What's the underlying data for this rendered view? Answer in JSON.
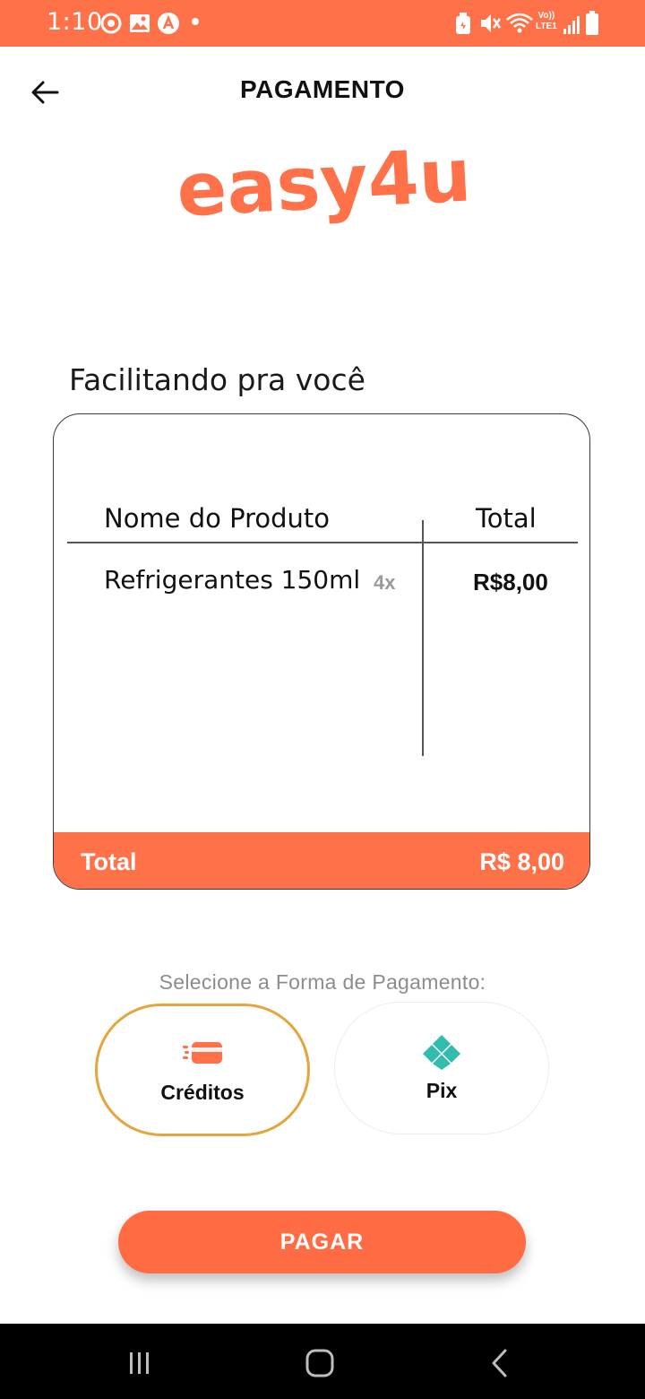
{
  "status_bar": {
    "time": "1:10",
    "icons": [
      "notification-icon",
      "gallery-icon",
      "app-icon",
      "dot-icon"
    ],
    "right_icons": [
      "battery-saver-icon",
      "mute-icon",
      "wifi-icon",
      "volte-icon",
      "signal-icon",
      "battery-icon"
    ],
    "volte_text": "Vo))",
    "lte_text": "LTE1",
    "color": "#ff7148"
  },
  "header": {
    "title": "PAGAMENTO",
    "back_icon": "arrow-left-icon"
  },
  "logo": {
    "text": "easy4u",
    "color": "#ff7148"
  },
  "section": {
    "title": "Facilitando pra você"
  },
  "table": {
    "headers": {
      "name": "Nome do Produto",
      "total": "Total"
    },
    "rows": [
      {
        "name": "Refrigerantes 150ml",
        "qty": "4x",
        "total": "R$8,00"
      }
    ],
    "footer": {
      "label": "Total",
      "value": "R$ 8,00"
    }
  },
  "payment": {
    "prompt": "Selecione a Forma de Pagamento:",
    "options": [
      {
        "label": "Créditos",
        "icon": "credit-card-icon",
        "selected": true
      },
      {
        "label": "Pix",
        "icon": "pix-icon",
        "selected": false
      }
    ],
    "accent_selected": "#e3a53c",
    "pix_color": "#32bcad"
  },
  "actions": {
    "pay_label": "PAGAR",
    "color": "#ff6b42"
  },
  "nav": {
    "icons": [
      "recent-apps-icon",
      "home-icon",
      "back-icon"
    ]
  }
}
